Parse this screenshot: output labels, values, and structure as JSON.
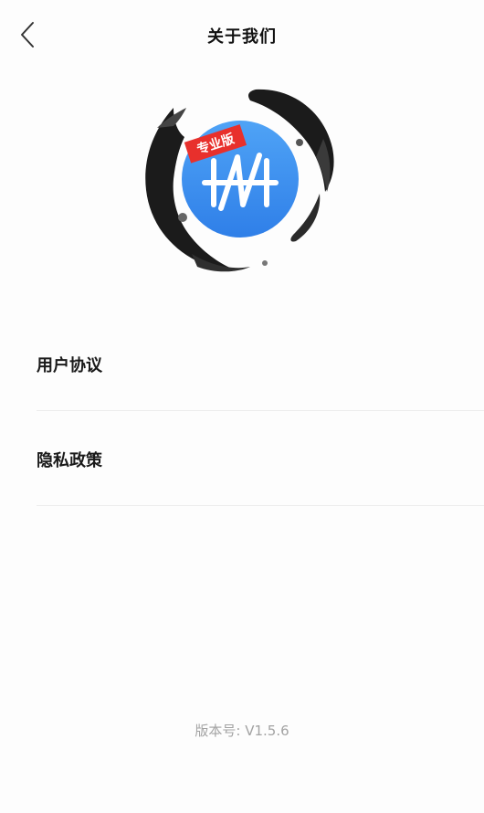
{
  "header": {
    "title": "关于我们",
    "back_icon": "chevron-left-icon"
  },
  "logo": {
    "badge_text": "专业版",
    "accent_color": "#3d8ef0",
    "badge_color": "#e8302c",
    "icon": "app-logo-icon"
  },
  "menu": {
    "items": [
      {
        "label": "用户协议"
      },
      {
        "label": "隐私政策"
      }
    ]
  },
  "footer": {
    "version_label": "版本号: V1.5.6"
  }
}
